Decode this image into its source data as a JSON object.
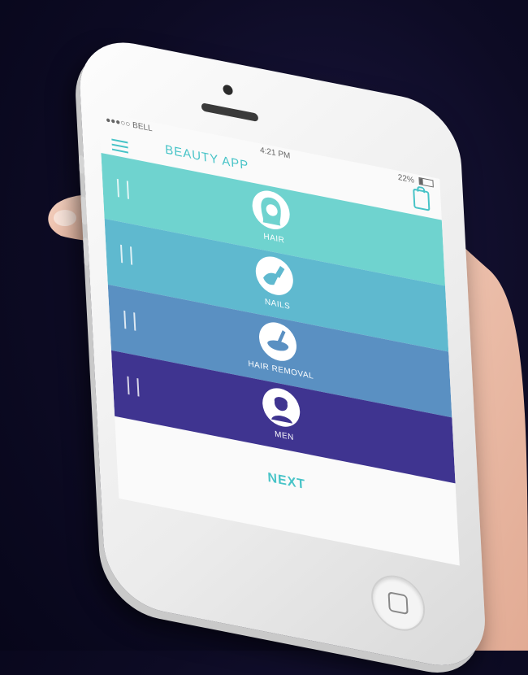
{
  "status": {
    "carrier": "●●●○○ BELL",
    "time": "4:21 PM",
    "battery": "22%"
  },
  "app": {
    "title": "BEAUTY APP"
  },
  "categories": [
    {
      "label": "HAIR",
      "color": "#6fd3cf",
      "icon": "woman-hair-icon"
    },
    {
      "label": "NAILS",
      "color": "#5fb9cf",
      "icon": "nail-polish-icon"
    },
    {
      "label": "HAIR REMOVAL",
      "color": "#5a90c2",
      "icon": "wax-bowl-icon"
    },
    {
      "label": "MEN",
      "color": "#3f3490",
      "icon": "man-icon"
    }
  ],
  "footer": {
    "next_label": "NEXT"
  },
  "colors": {
    "accent": "#46c3c7",
    "background": "#0d0b24"
  }
}
